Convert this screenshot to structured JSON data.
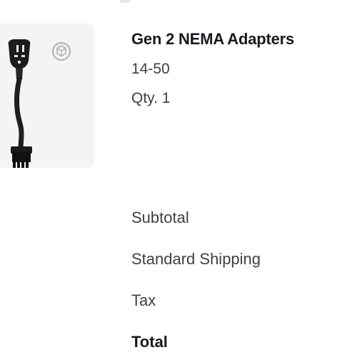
{
  "product": {
    "title": "Gen 2 NEMA Adapters",
    "variant": "14-50",
    "quantity": "Qty. 1",
    "image": "nema-adapter-image",
    "ar_icon": "view-in-ar-icon"
  },
  "summary": {
    "subtotal_label": "Subtotal",
    "shipping_label": "Standard Shipping",
    "tax_label": "Tax",
    "total_label": "Total"
  },
  "colors": {
    "text_primary": "#171a20",
    "text_secondary": "#3e4046",
    "card_background": "#f4f4f4"
  }
}
